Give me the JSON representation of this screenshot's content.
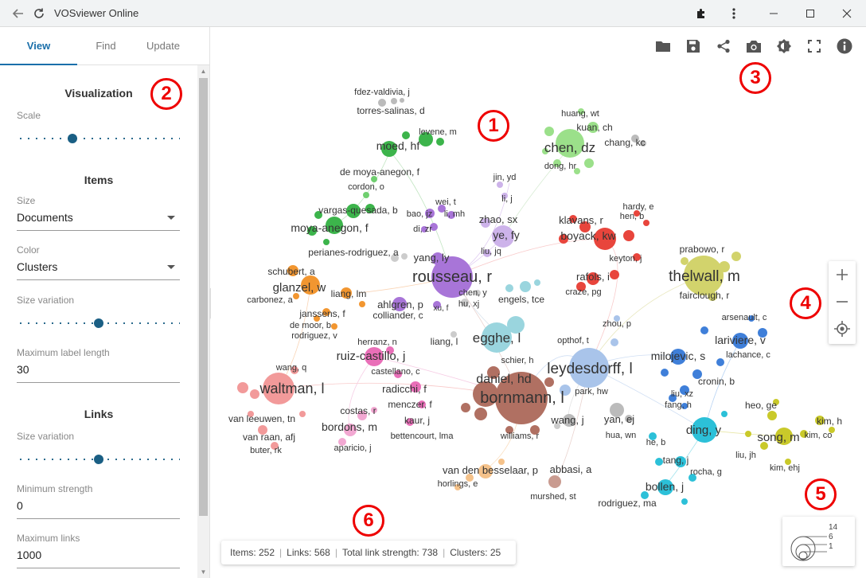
{
  "window": {
    "title": "VOSviewer Online"
  },
  "tabs": [
    {
      "label": "View"
    },
    {
      "label": "Find"
    },
    {
      "label": "Update"
    }
  ],
  "panel": {
    "visualization_title": "Visualization",
    "scale_label": "Scale",
    "scale_value": 0.33,
    "items_title": "Items",
    "size_label": "Size",
    "size_value": "Documents",
    "color_label": "Color",
    "color_value": "Clusters",
    "size_variation_label": "Size variation",
    "items_size_variation": 0.5,
    "max_label_length_label": "Maximum label length",
    "max_label_length_value": "30",
    "links_title": "Links",
    "links_size_variation_label": "Size variation",
    "links_size_variation": 0.5,
    "min_strength_label": "Minimum strength",
    "min_strength_value": "0",
    "max_links_label": "Maximum links",
    "max_links_value": "1000"
  },
  "status": {
    "items": "Items: 252",
    "links": "Links: 568",
    "total_link_strength": "Total link strength: 738",
    "clusters": "Clusters: 25"
  },
  "legend": {
    "max": "14",
    "mid": "6",
    "min": "1"
  },
  "badges": [
    "1",
    "2",
    "3",
    "4",
    "5",
    "6"
  ],
  "toolbar_icons": [
    "folder-icon",
    "save-icon",
    "share-icon",
    "camera-icon",
    "brightness-icon",
    "fullscreen-icon",
    "info-icon"
  ],
  "colors": {
    "accent": "#1a6faa",
    "slider": "#1a5f84",
    "badge": "#e00000"
  },
  "labels": {
    "fdez_valdivia": "fdez-valdivia, j",
    "torres_salinas": "torres-salinas, d",
    "levene": "levene, m",
    "moed": "moed, hf",
    "de_moya_anegon": "de moya-anegon, f",
    "cordon": "cordon, o",
    "vargas_quesada": "vargas-quesada, b",
    "moya_anegon": "moya-anegon, f",
    "perianes": "perianes-rodriguez, a",
    "huang_wt": "huang, wt",
    "kuan_ch": "kuan, ch",
    "chen_dz": "chen, dz",
    "chang_kc": "chang, kc",
    "dong_hr": "dong, hr",
    "jin_yd": "jin, yd",
    "li_j": "li, j",
    "wei_t": "wei, t",
    "bao_jz": "bao, jz",
    "li_mh": "li, mh",
    "di_zr": "di, zr",
    "zhao_sx": "zhao, sx",
    "ye_fy": "ye, fy",
    "liu_jq": "liu, jq",
    "yang_ly": "yang, ly",
    "rousseau": "rousseau, r",
    "chen_y": "chen, y",
    "hu_xj": "hu, xj",
    "xu_f": "xu, f",
    "hardy": "hardy, e",
    "hen_b": "hen, b",
    "klavans": "klavans, r",
    "boyack": "boyack, kw",
    "keyton": "keyton, j",
    "rafols": "rafols, i",
    "craze": "craze, pg",
    "prabowo": "prabowo, r",
    "thelwall": "thelwall, m",
    "fairclough": "fairclough, r",
    "schubert": "schubert, a",
    "glanzel": "glanzel, w",
    "carbonez": "carbonez, a",
    "liang_lm": "liang, lm",
    "janssens": "janssens, f",
    "de_moor": "de moor, b",
    "rodriguez_v": "rodriguez, v",
    "ahlgren": "ahlgren, p",
    "colliander": "colliander, c",
    "engels": "engels, tce",
    "egghe": "egghe, l",
    "liang_l": "liang, l",
    "opthof": "opthof, t",
    "zhou_p": "zhou, p",
    "arsenault": "arsenault, c",
    "lariviere": "lariviere, v",
    "lachance": "lachance, c",
    "milojevic": "milojevic, s",
    "cronin": "cronin, b",
    "liu_xz": "liu, xz",
    "fang_h": "fang, h",
    "herranz": "herranz, n",
    "ruiz_castillo": "ruiz-castillo, j",
    "castellano": "castellano, c",
    "schier": "schier, h",
    "daniel": "daniel, hd",
    "leydesdorff": "leydesdorff, l",
    "bornmann": "bornmann, l",
    "park_hw": "park, hw",
    "wang_q": "wang, q",
    "waltman": "waltman, l",
    "radicchi": "radicchi, f",
    "menczer": "menczer, f",
    "kaur": "kaur, j",
    "bettencourt": "bettencourt, lma",
    "costas": "costas, r",
    "bordons": "bordons, m",
    "aparicio": "aparicio, j",
    "van_leeuwen": "van leeuwen, tn",
    "van_raan": "van raan, afj",
    "buter": "buter, rk",
    "wang_j": "wang, j",
    "williams": "williams, r",
    "yan_ej": "yan, ej",
    "hua_wn": "hua, wn",
    "heo_ge": "heo, ge",
    "song_m": "song, m",
    "kim_h": "kim, h",
    "kim_co": "kim, co",
    "liu_jh": "liu, jh",
    "kim_ehj": "kim, ehj",
    "ding_y": "ding, y",
    "he_b": "he, b",
    "tang_j": "tang, j",
    "rocha": "rocha, g",
    "bollen": "bollen, j",
    "rodriguez_ma": "rodriguez, ma",
    "van_den_besselaar": "van den besselaar, p",
    "horlings": "horlings, e",
    "abbasi": "abbasi, a",
    "murshed": "murshed, st"
  }
}
